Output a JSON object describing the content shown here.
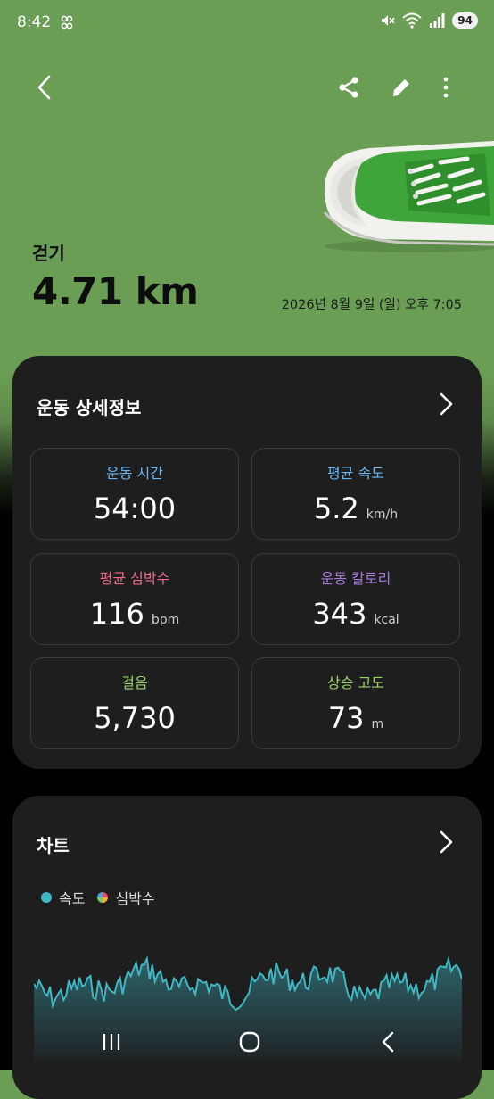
{
  "status_bar": {
    "time": "8:42",
    "battery": "94"
  },
  "header": {
    "workout_name": "걷기",
    "distance": "4.71 km",
    "date": "2026년 8월 9일 (일) 오후 7:05"
  },
  "details": {
    "title": "운동 상세정보",
    "stats": [
      {
        "label": "운동 시간",
        "value": "54:00",
        "unit": "",
        "color": "#6ab4ef"
      },
      {
        "label": "평균 속도",
        "value": "5.2",
        "unit": "km/h",
        "color": "#6ab4ef"
      },
      {
        "label": "평균 심박수",
        "value": "116",
        "unit": "bpm",
        "color": "#f06b8a"
      },
      {
        "label": "운동 칼로리",
        "value": "343",
        "unit": "kcal",
        "color": "#a57be0"
      },
      {
        "label": "걸음",
        "value": "5,730",
        "unit": "",
        "color": "#9bd36a"
      },
      {
        "label": "상승 고도",
        "value": "73",
        "unit": "m",
        "color": "#9bd36a"
      }
    ]
  },
  "chart": {
    "title": "차트",
    "legend": [
      {
        "name": "속도",
        "color": "#3fb8c4"
      },
      {
        "name": "심박수",
        "color": "#e8954a"
      }
    ],
    "series_color": "#3fb8c4"
  },
  "colors": {
    "header_bg": "#6a9e55",
    "card_bg": "#1e1e1f"
  }
}
